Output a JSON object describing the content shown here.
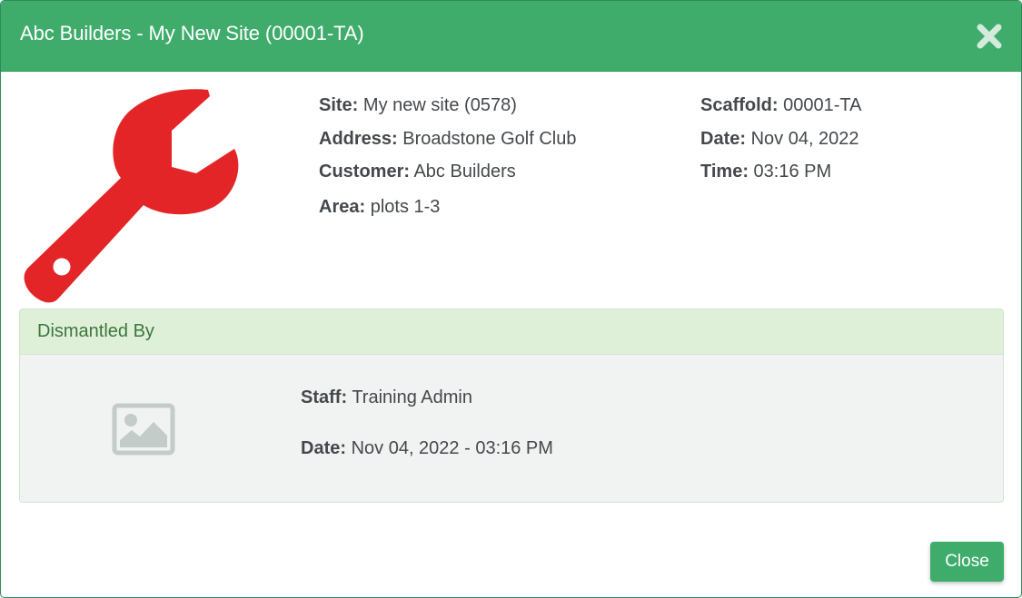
{
  "modal": {
    "title": "Abc Builders - My New Site (00001-TA)",
    "close_icon": "close-x-icon",
    "accent_color": "#3fac6b"
  },
  "details": {
    "icon": "wrench-icon",
    "icon_color": "#e42527",
    "site_label": "Site:",
    "site_value": "My new site (0578)",
    "address_label": "Address:",
    "address_value": "Broadstone Golf Club",
    "customer_label": "Customer:",
    "customer_value": "Abc Builders",
    "area_label": "Area:",
    "area_value": "plots 1-3",
    "scaffold_label": "Scaffold:",
    "scaffold_value": "00001-TA",
    "date_label": "Date:",
    "date_value": "Nov 04, 2022",
    "time_label": "Time:",
    "time_value": "03:16 PM"
  },
  "dismantled": {
    "heading": "Dismantled By",
    "image_icon": "image-placeholder-icon",
    "staff_label": "Staff:",
    "staff_value": "Training Admin",
    "date_label": "Date:",
    "date_value": "Nov 04, 2022 - 03:16 PM"
  },
  "footer": {
    "close_label": "Close"
  }
}
